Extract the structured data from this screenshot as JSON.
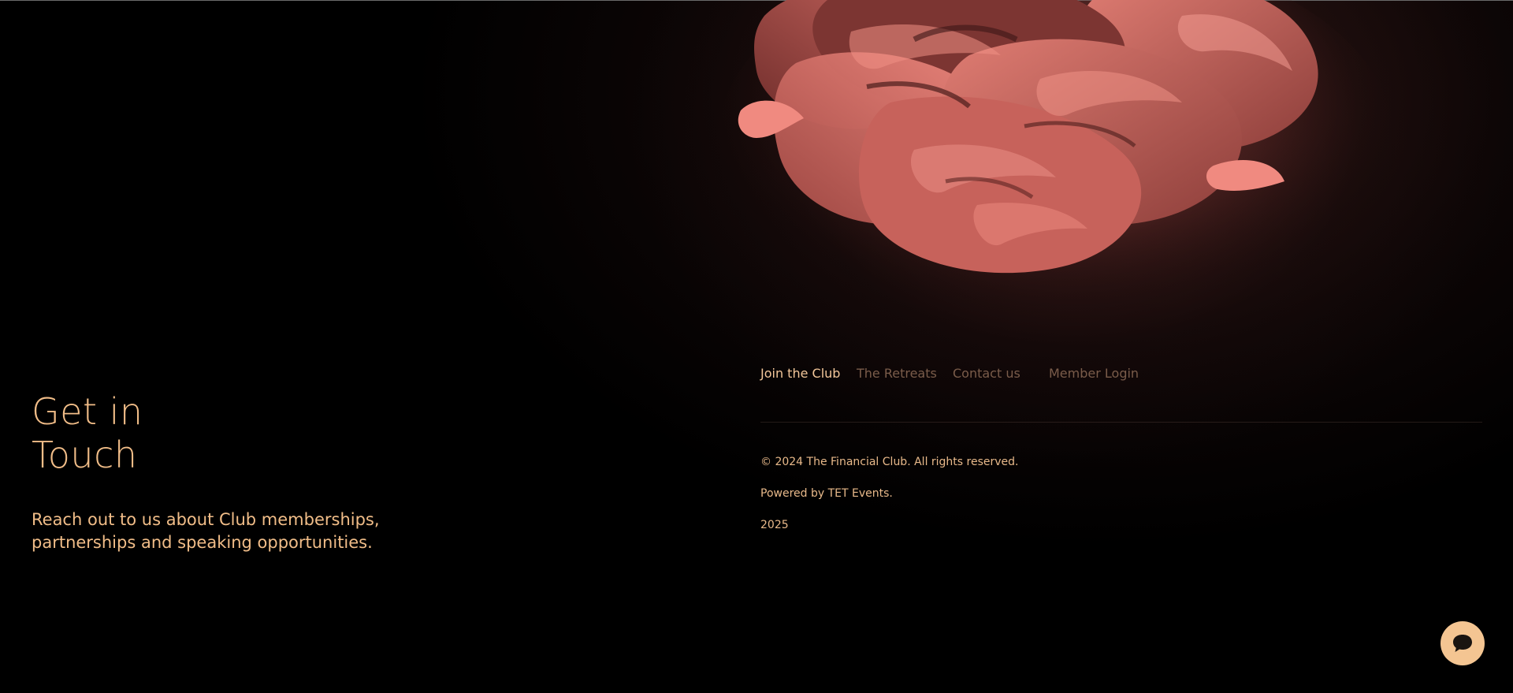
{
  "contact": {
    "title_line1": "Get in",
    "title_line2": "Touch",
    "text": "Reach out to us about Club memberships, partnerships and speaking opportunities."
  },
  "footer": {
    "nav": [
      {
        "label": "Join the Club",
        "active": true
      },
      {
        "label": "The Retreats",
        "active": false
      },
      {
        "label": "Contact us",
        "active": false
      },
      {
        "label": "Member Login",
        "active": false
      }
    ],
    "copyright": "© 2024 The Financial Club. All rights reserved.",
    "powered_by": "Powered by TET Events.",
    "year": "2025"
  },
  "chat": {
    "icon": "chat-bubble-icon"
  },
  "colors": {
    "accent": "#f1bd88",
    "nav_inactive": "#7a5c4a",
    "chat_bg": "#f4c592",
    "hero_flower": "#d4736b"
  }
}
